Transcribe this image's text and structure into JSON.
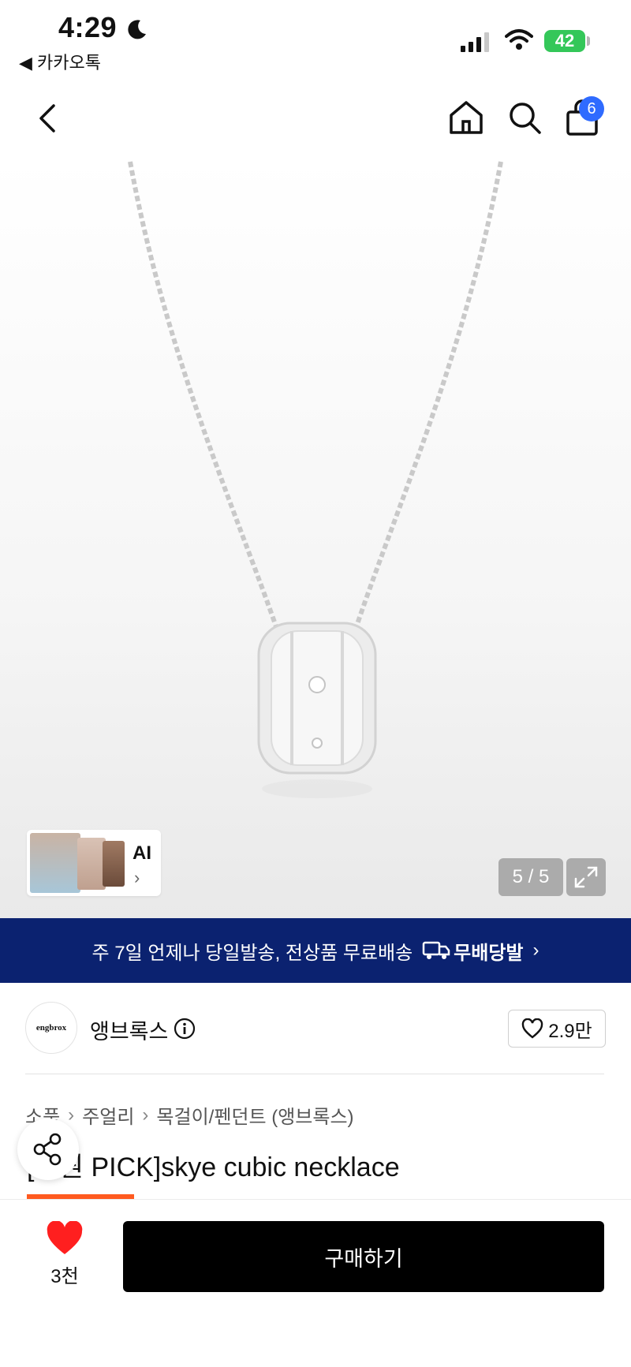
{
  "status_bar": {
    "time": "4:29",
    "back_app": "◀ 카카오톡",
    "battery": "42"
  },
  "nav": {
    "cart_count": "6"
  },
  "gallery": {
    "ai_label": "AI",
    "ai_arrow": "›",
    "counter": "5 / 5"
  },
  "banner": {
    "text": "주 7일 언제나 당일발송, 전상품 무료배송",
    "logo": "무배당발",
    "arrow": "›"
  },
  "store": {
    "logo_text": "engbrox",
    "name": "앵브록스",
    "likes": "2.9만"
  },
  "breadcrumb": [
    "소품",
    "주얼리",
    "목걸이/펜던트 (앵브록스)"
  ],
  "product": {
    "title": "[지원 PICK]skye cubic necklace"
  },
  "bottom": {
    "heart_count": "3천",
    "buy_label": "구매하기"
  },
  "colors": {
    "accent_blue": "#2f6bff",
    "banner_bg": "#0b2270",
    "heart_red": "#ff1f1f",
    "battery_green": "#34c759"
  }
}
